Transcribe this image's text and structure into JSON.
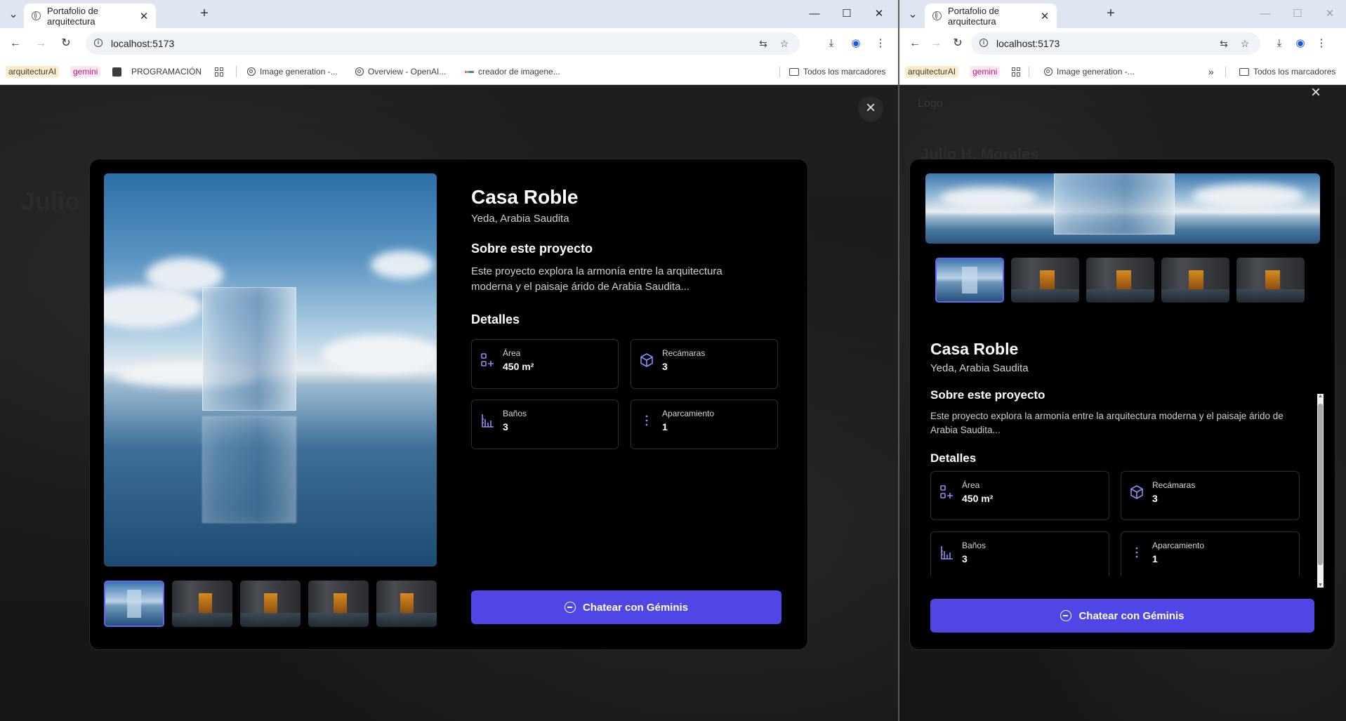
{
  "browser": {
    "tab_title": "Portafolio de arquitectura",
    "url": "localhost:5173",
    "bookmarks": {
      "arquitectura": "arquitecturAI",
      "gemini": "gemini",
      "programacion": "PROGRAMACIÓN",
      "image_gen": "Image generation -...",
      "overview": "Overview - OpenAI...",
      "creador": "creador de imagene...",
      "todos": "Todos los marcadores",
      "overflow": "»"
    }
  },
  "background_page": {
    "name_left": "Julio",
    "logo": "Logo",
    "name_right": "Julio H. Morales"
  },
  "project": {
    "title": "Casa Roble",
    "location": "Yeda, Arabia Saudita",
    "about_heading": "Sobre este proyecto",
    "description": "Este proyecto explora la armonía entre la arquitectura moderna y el paisaje árido de Arabia Saudita...",
    "details_heading": "Detalles",
    "details": [
      {
        "label": "Área",
        "value": "450 m²",
        "icon": "area-icon"
      },
      {
        "label": "Recámaras",
        "value": "3",
        "icon": "cube-icon"
      },
      {
        "label": "Baños",
        "value": "3",
        "icon": "bath-icon"
      },
      {
        "label": "Aparcamiento",
        "value": "1",
        "icon": "more-vertical-icon"
      }
    ],
    "cta_label": "Chatear con Géminis",
    "thumbnail_count": 5,
    "active_thumbnail": 1
  },
  "colors": {
    "accent": "#4f46e5",
    "active_border": "#6366f1",
    "icon": "#8b8ef5",
    "modal_bg": "#000000"
  }
}
